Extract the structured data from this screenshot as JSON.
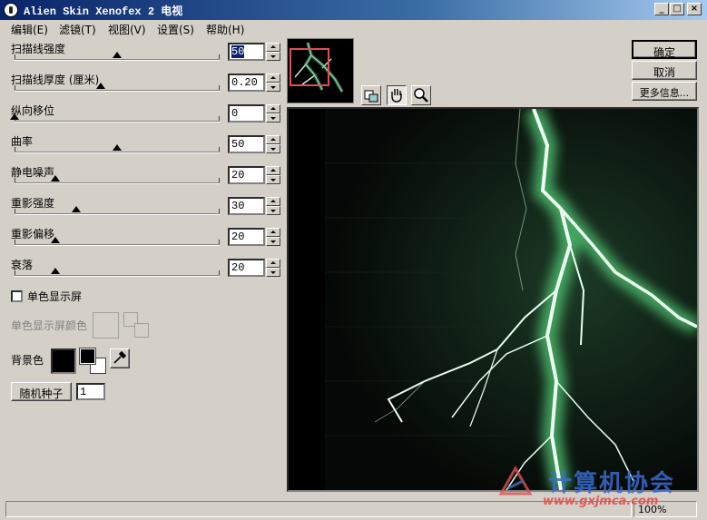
{
  "window": {
    "title": "Alien Skin Xenofex 2 电视"
  },
  "menu": [
    "编辑(E)",
    "滤镜(T)",
    "视图(V)",
    "设置(S)",
    "帮助(H)"
  ],
  "params": [
    {
      "label": "扫描线强度",
      "value": "50",
      "slider_fraction": 0.5,
      "selected": true
    },
    {
      "label": "扫描线厚度 (厘米)",
      "value": "0.20",
      "slider_fraction": 0.42,
      "selected": false
    },
    {
      "label": "纵向移位",
      "value": "0",
      "slider_fraction": 0.0,
      "selected": false
    },
    {
      "label": "曲率",
      "value": "50",
      "slider_fraction": 0.5,
      "selected": false
    },
    {
      "label": "静电噪声",
      "value": "20",
      "slider_fraction": 0.2,
      "selected": false
    },
    {
      "label": "重影强度",
      "value": "30",
      "slider_fraction": 0.3,
      "selected": false
    },
    {
      "label": "重影偏移",
      "value": "20",
      "slider_fraction": 0.2,
      "selected": false
    },
    {
      "label": "衰落",
      "value": "20",
      "slider_fraction": 0.2,
      "selected": false
    }
  ],
  "mono": {
    "checkbox_label": "单色显示屏",
    "checked": false,
    "color_label": "单色显示屏颜色"
  },
  "background": {
    "label": "背景色",
    "color": "#000000"
  },
  "random": {
    "button_label": "随机种子",
    "value": "1"
  },
  "buttons": {
    "ok": "确定",
    "cancel": "取消",
    "more": "更多信息..."
  },
  "status": {
    "zoom": "100%"
  },
  "watermark": {
    "text": "计算机协会",
    "url": "www.gxjmca.com"
  },
  "colors": {
    "title_start": "#0a246a",
    "title_end": "#a6caf0",
    "glow": "#6fd08a"
  },
  "icons": [
    "app-icon",
    "minimize-icon",
    "maximize-icon",
    "close-icon",
    "preview-compare-icon",
    "hand-icon",
    "zoom-icon",
    "eyedropper-icon"
  ]
}
